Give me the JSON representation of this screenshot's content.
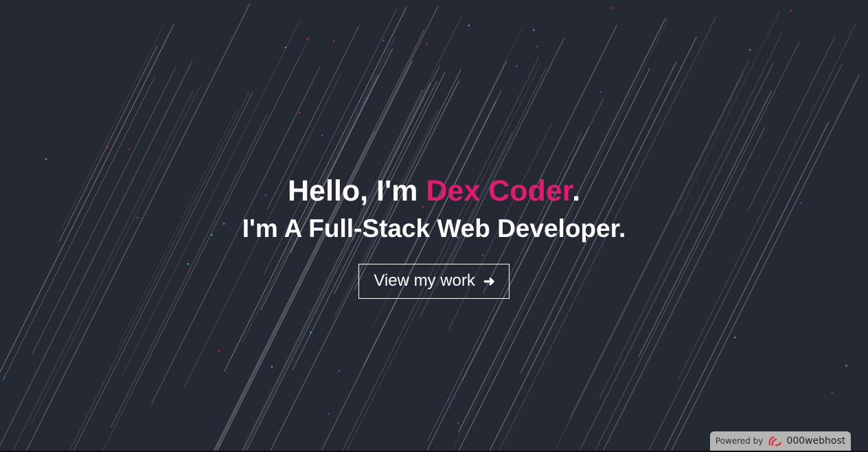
{
  "hero": {
    "greeting": "Hello, I'm ",
    "name": "Dex Coder",
    "period": ".",
    "tagline": "I'm A Full-Stack Web Developer.",
    "cta_label": "View my work",
    "cta_icon": "arrow-right-icon"
  },
  "footer_badge": {
    "powered_by": "Powered by",
    "brand": "000webhost"
  },
  "colors": {
    "background": "#252934",
    "accent": "#e31b6d"
  }
}
